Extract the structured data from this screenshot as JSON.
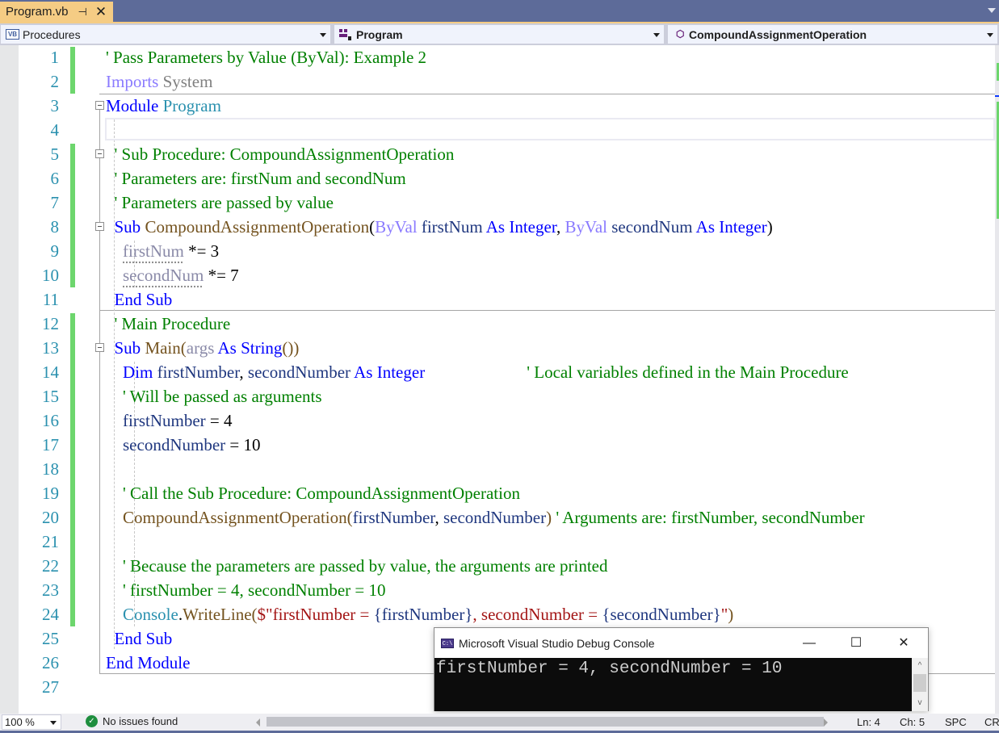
{
  "tab": {
    "title": "Program.vb",
    "pin_glyph": "⊣",
    "close_glyph": "✕"
  },
  "navbar": {
    "project_dropdown": "Procedures",
    "type_dropdown": "Program",
    "member_dropdown": "CompoundAssignmentOperation",
    "vb_badge": "VB"
  },
  "editor": {
    "line_numbers": [
      "1",
      "2",
      "3",
      "4",
      "5",
      "6",
      "7",
      "8",
      "9",
      "10",
      "11",
      "12",
      "13",
      "14",
      "15",
      "16",
      "17",
      "18",
      "19",
      "20",
      "21",
      "22",
      "23",
      "24",
      "25",
      "26",
      "27"
    ],
    "lines": [
      [
        [
          "c",
          "' Pass Parameters by Value (ByVal): Example 2"
        ]
      ],
      [
        [
          "kp",
          "Imports"
        ],
        [
          "gr",
          " System"
        ]
      ],
      [
        [
          "k",
          "Module"
        ],
        [
          "",
          ""
        ],
        [
          "t",
          " Program"
        ]
      ],
      [],
      [
        [
          "",
          "  "
        ],
        [
          "c",
          "' Sub Procedure: CompoundAssignmentOperation"
        ]
      ],
      [
        [
          "",
          "  "
        ],
        [
          "c",
          "' Parameters are: firstNum and secondNum"
        ]
      ],
      [
        [
          "",
          "  "
        ],
        [
          "c",
          "' Parameters are passed by value"
        ]
      ],
      [
        [
          "",
          "  "
        ],
        [
          "k",
          "Sub"
        ],
        [
          "",
          " "
        ],
        [
          "m",
          "CompoundAssignmentOperation"
        ],
        [
          "",
          "("
        ],
        [
          "kp",
          "ByVal"
        ],
        [
          "",
          " "
        ],
        [
          "p",
          "firstNum"
        ],
        [
          "",
          " "
        ],
        [
          "k",
          "As"
        ],
        [
          "",
          " "
        ],
        [
          "k",
          "Integer"
        ],
        [
          "",
          ", "
        ],
        [
          "kp",
          "ByVal"
        ],
        [
          "",
          " "
        ],
        [
          "p",
          "secondNum"
        ],
        [
          "",
          " "
        ],
        [
          "k",
          "As"
        ],
        [
          "",
          " "
        ],
        [
          "k",
          "Integer"
        ],
        [
          "",
          ")"
        ]
      ],
      [
        [
          "",
          "    "
        ],
        [
          "pu",
          "firstNum"
        ],
        [
          "",
          " *= 3"
        ]
      ],
      [
        [
          "",
          "    "
        ],
        [
          "pu",
          "secondNum"
        ],
        [
          "",
          " *= 7"
        ]
      ],
      [
        [
          "",
          "  "
        ],
        [
          "k",
          "End Sub"
        ]
      ],
      [
        [
          "",
          "  "
        ],
        [
          "c",
          "' Main Procedure"
        ]
      ],
      [
        [
          "",
          "  "
        ],
        [
          "k",
          "Sub"
        ],
        [
          "",
          " "
        ],
        [
          "m",
          "Main("
        ],
        [
          "pu",
          "args"
        ],
        [
          "",
          " "
        ],
        [
          "k",
          "As"
        ],
        [
          "",
          " "
        ],
        [
          "k",
          "String"
        ],
        [
          "m",
          "())"
        ]
      ],
      [
        [
          "",
          "    "
        ],
        [
          "k",
          "Dim"
        ],
        [
          "",
          " "
        ],
        [
          "p",
          "firstNumber"
        ],
        [
          "",
          ", "
        ],
        [
          "p",
          "secondNumber"
        ],
        [
          "",
          " "
        ],
        [
          "k",
          "As"
        ],
        [
          "",
          " "
        ],
        [
          "k",
          "Integer"
        ],
        [
          "",
          "                        "
        ],
        [
          "c",
          "' Local variables defined in the Main Procedure"
        ]
      ],
      [
        [
          "",
          "    "
        ],
        [
          "c",
          "' Will be passed as arguments"
        ]
      ],
      [
        [
          "",
          "    "
        ],
        [
          "p",
          "firstNumber"
        ],
        [
          "",
          " = 4"
        ]
      ],
      [
        [
          "",
          "    "
        ],
        [
          "p",
          "secondNumber"
        ],
        [
          "",
          " = 10"
        ]
      ],
      [],
      [
        [
          "",
          "    "
        ],
        [
          "c",
          "' Call the Sub Procedure: CompoundAssignmentOperation"
        ]
      ],
      [
        [
          "",
          "    "
        ],
        [
          "m",
          "CompoundAssignmentOperation("
        ],
        [
          "p",
          "firstNumber"
        ],
        [
          "",
          ", "
        ],
        [
          "p",
          "secondNumber"
        ],
        [
          "m",
          ")"
        ],
        [
          "",
          " "
        ],
        [
          "c",
          "' Arguments are: firstNumber, secondNumber"
        ]
      ],
      [],
      [
        [
          "",
          "    "
        ],
        [
          "c",
          "' Because the parameters are passed by value, the arguments are printed"
        ]
      ],
      [
        [
          "",
          "    "
        ],
        [
          "c",
          "' firstNumber = 4, secondNumber = 10"
        ]
      ],
      [
        [
          "",
          "    "
        ],
        [
          "t",
          "Console"
        ],
        [
          "",
          "."
        ],
        [
          "m",
          "WriteLine("
        ],
        [
          "s",
          "$\"firstNumber = "
        ],
        [
          "p",
          "{firstNumber}"
        ],
        [
          "s",
          ", secondNumber = "
        ],
        [
          "p",
          "{secondNumber}"
        ],
        [
          "s",
          "\""
        ],
        [
          "m",
          ")"
        ]
      ],
      [
        [
          "",
          "  "
        ],
        [
          "k",
          "End Sub"
        ]
      ],
      [
        [
          "k",
          "End Module"
        ]
      ],
      []
    ]
  },
  "console": {
    "title": "Microsoft Visual Studio Debug Console",
    "icon_text": "C:\\",
    "output": "firstNumber = 4, secondNumber = 10",
    "minimize_glyph": "—",
    "maximize_glyph": "☐",
    "close_glyph": "✕",
    "scroll_up_glyph": "^",
    "scroll_down_glyph": "v"
  },
  "statusbar": {
    "zoom": "100 %",
    "issues": "No issues found",
    "check_glyph": "✓",
    "line": "Ln: 4",
    "column": "Ch: 5",
    "whitespace": "SPC",
    "line_ending": "CR"
  },
  "colors": {
    "tab_active": "#f5cc84",
    "chrome": "#5d6b99",
    "change_bar": "#6dd66d",
    "comment": "#008000",
    "keyword": "#0000ff",
    "type": "#2b91af",
    "method": "#74531f",
    "string": "#a31515",
    "line_number": "#2b91af"
  }
}
